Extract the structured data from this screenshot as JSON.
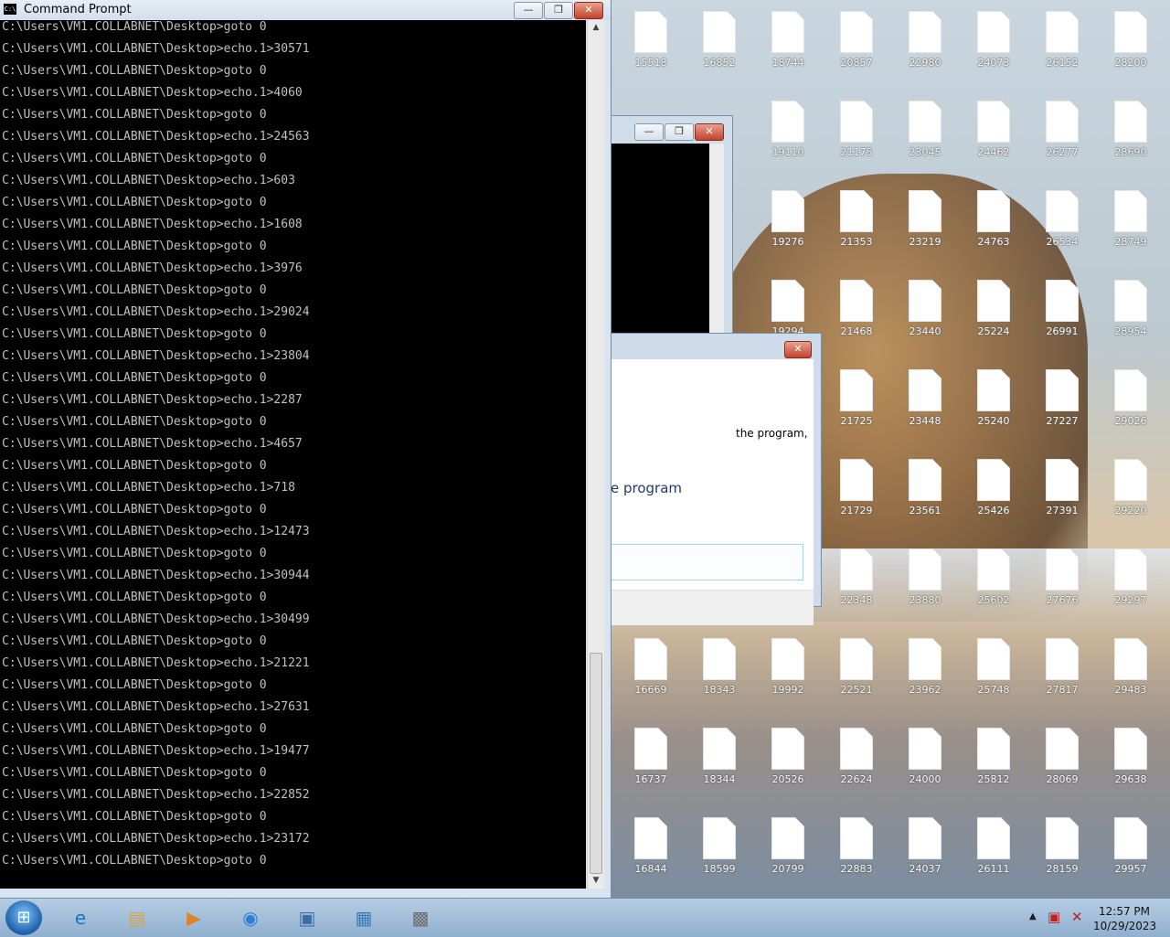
{
  "cmd_window": {
    "title": "Command Prompt",
    "lines": [
      "C:\\Users\\VM1.COLLABNET\\Desktop>goto 0",
      "C:\\Users\\VM1.COLLABNET\\Desktop>echo.1>30571",
      "C:\\Users\\VM1.COLLABNET\\Desktop>goto 0",
      "C:\\Users\\VM1.COLLABNET\\Desktop>echo.1>4060",
      "C:\\Users\\VM1.COLLABNET\\Desktop>goto 0",
      "C:\\Users\\VM1.COLLABNET\\Desktop>echo.1>24563",
      "C:\\Users\\VM1.COLLABNET\\Desktop>goto 0",
      "C:\\Users\\VM1.COLLABNET\\Desktop>echo.1>603",
      "C:\\Users\\VM1.COLLABNET\\Desktop>goto 0",
      "C:\\Users\\VM1.COLLABNET\\Desktop>echo.1>1608",
      "C:\\Users\\VM1.COLLABNET\\Desktop>goto 0",
      "C:\\Users\\VM1.COLLABNET\\Desktop>echo.1>3976",
      "C:\\Users\\VM1.COLLABNET\\Desktop>goto 0",
      "C:\\Users\\VM1.COLLABNET\\Desktop>echo.1>29024",
      "C:\\Users\\VM1.COLLABNET\\Desktop>goto 0",
      "C:\\Users\\VM1.COLLABNET\\Desktop>echo.1>23804",
      "C:\\Users\\VM1.COLLABNET\\Desktop>goto 0",
      "C:\\Users\\VM1.COLLABNET\\Desktop>echo.1>2287",
      "C:\\Users\\VM1.COLLABNET\\Desktop>goto 0",
      "C:\\Users\\VM1.COLLABNET\\Desktop>echo.1>4657",
      "C:\\Users\\VM1.COLLABNET\\Desktop>goto 0",
      "C:\\Users\\VM1.COLLABNET\\Desktop>echo.1>718",
      "C:\\Users\\VM1.COLLABNET\\Desktop>goto 0",
      "C:\\Users\\VM1.COLLABNET\\Desktop>echo.1>12473",
      "C:\\Users\\VM1.COLLABNET\\Desktop>goto 0",
      "C:\\Users\\VM1.COLLABNET\\Desktop>echo.1>30944",
      "C:\\Users\\VM1.COLLABNET\\Desktop>goto 0",
      "C:\\Users\\VM1.COLLABNET\\Desktop>echo.1>30499",
      "C:\\Users\\VM1.COLLABNET\\Desktop>goto 0",
      "C:\\Users\\VM1.COLLABNET\\Desktop>echo.1>21221",
      "C:\\Users\\VM1.COLLABNET\\Desktop>goto 0",
      "C:\\Users\\VM1.COLLABNET\\Desktop>echo.1>27631",
      "C:\\Users\\VM1.COLLABNET\\Desktop>goto 0",
      "C:\\Users\\VM1.COLLABNET\\Desktop>echo.1>19477",
      "C:\\Users\\VM1.COLLABNET\\Desktop>goto 0",
      "C:\\Users\\VM1.COLLABNET\\Desktop>echo.1>22852",
      "C:\\Users\\VM1.COLLABNET\\Desktop>goto 0",
      "C:\\Users\\VM1.COLLABNET\\Desktop>echo.1>23172",
      "C:\\Users\\VM1.COLLABNET\\Desktop>goto 0"
    ],
    "buttons": {
      "minimize": "—",
      "restore": "❐",
      "close": "✕"
    }
  },
  "dialog": {
    "text_fragment_1": "the program,",
    "text_fragment_2": "e program",
    "close": "✕"
  },
  "desktop_icons": [
    [
      "15518",
      "16852",
      "18744",
      "20857",
      "22980",
      "24073",
      "26152",
      "28200"
    ],
    [
      "",
      "",
      "19110",
      "21175",
      "23045",
      "24462",
      "26277",
      "28690"
    ],
    [
      "",
      "",
      "19276",
      "21353",
      "23219",
      "24763",
      "26534",
      "28749"
    ],
    [
      "",
      "",
      "19294",
      "21468",
      "23440",
      "25224",
      "26991",
      "28954"
    ],
    [
      "",
      "",
      "",
      "21725",
      "23448",
      "25240",
      "27227",
      "29026"
    ],
    [
      "",
      "",
      "",
      "21729",
      "23561",
      "25426",
      "27391",
      "29220"
    ],
    [
      "",
      "",
      "",
      "22348",
      "23880",
      "25602",
      "27676",
      "29297"
    ],
    [
      "16669",
      "18343",
      "19992",
      "22521",
      "23962",
      "25748",
      "27817",
      "29483"
    ],
    [
      "16737",
      "18344",
      "20526",
      "22624",
      "24000",
      "25812",
      "28069",
      "29638"
    ],
    [
      "16844",
      "18599",
      "20799",
      "22883",
      "24037",
      "26111",
      "28159",
      "29957"
    ]
  ],
  "taskbar": {
    "apps": [
      {
        "name": "internet-explorer",
        "glyph": "e",
        "color": "#1e73c8"
      },
      {
        "name": "file-explorer",
        "glyph": "▤",
        "color": "#d9a441"
      },
      {
        "name": "media-player",
        "glyph": "▶",
        "color": "#e0822c"
      },
      {
        "name": "chrome",
        "glyph": "◉",
        "color": "#2f7fd6"
      },
      {
        "name": "remote-desktop",
        "glyph": "▣",
        "color": "#3b6ea5"
      },
      {
        "name": "network-app",
        "glyph": "▦",
        "color": "#3d7bb8"
      },
      {
        "name": "firewall-app",
        "glyph": "▩",
        "color": "#6b6b6b"
      }
    ],
    "time": "12:57 PM",
    "date": "10/29/2023"
  }
}
